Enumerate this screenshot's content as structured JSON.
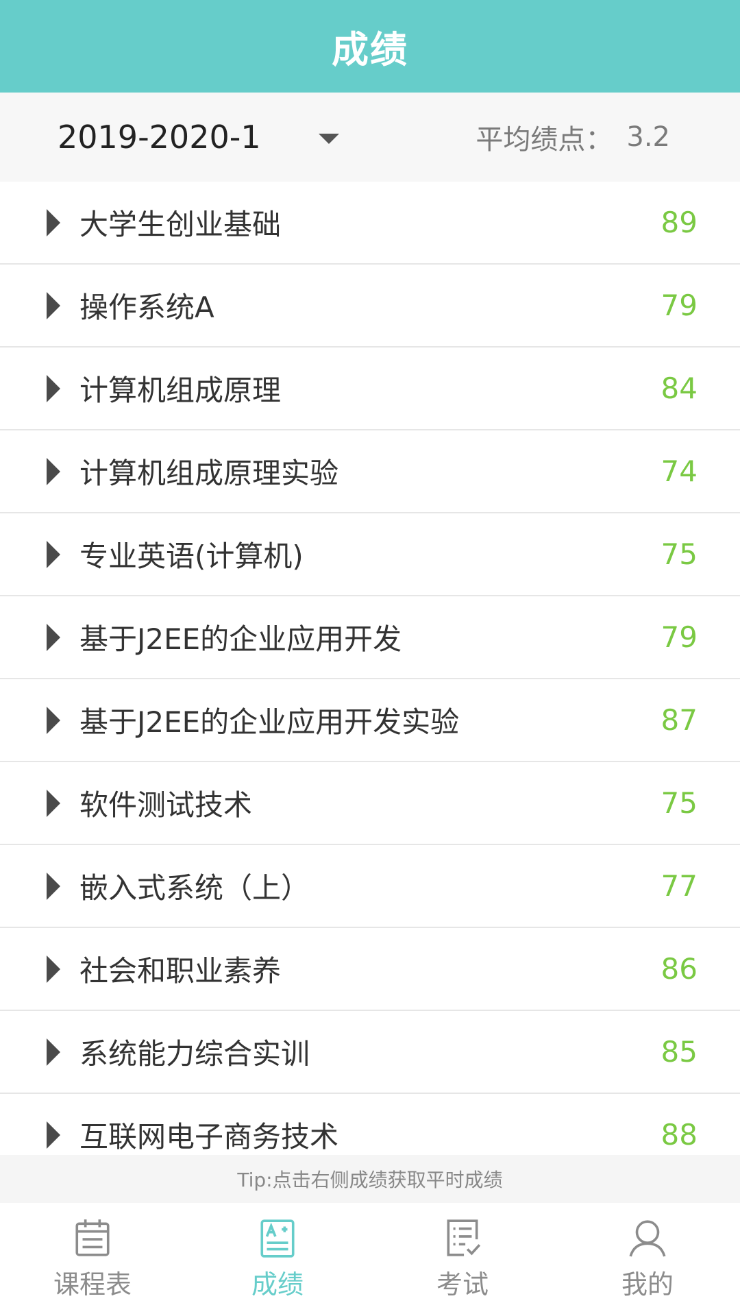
{
  "header": {
    "title": "成绩"
  },
  "term": {
    "selected": "2019-2020-1"
  },
  "gpa": {
    "label": "平均绩点：",
    "value": "3.2"
  },
  "courses": [
    {
      "name": "大学生创业基础",
      "score": "89"
    },
    {
      "name": "操作系统A",
      "score": "79"
    },
    {
      "name": "计算机组成原理",
      "score": "84"
    },
    {
      "name": "计算机组成原理实验",
      "score": "74"
    },
    {
      "name": "专业英语(计算机)",
      "score": "75"
    },
    {
      "name": "基于J2EE的企业应用开发",
      "score": "79"
    },
    {
      "name": "基于J2EE的企业应用开发实验",
      "score": "87"
    },
    {
      "name": "软件测试技术",
      "score": "75"
    },
    {
      "name": "嵌入式系统（上）",
      "score": "77"
    },
    {
      "name": "社会和职业素养",
      "score": "86"
    },
    {
      "name": "系统能力综合实训",
      "score": "85"
    },
    {
      "name": "互联网电子商务技术",
      "score": "88"
    }
  ],
  "tip": "Tip:点击右侧成绩获取平时成绩",
  "tabs": [
    {
      "label": "课程表",
      "icon": "calendar-icon",
      "active": false
    },
    {
      "label": "成绩",
      "icon": "grade-icon",
      "active": true
    },
    {
      "label": "考试",
      "icon": "exam-checklist-icon",
      "active": false
    },
    {
      "label": "我的",
      "icon": "user-icon",
      "active": false
    }
  ],
  "colors": {
    "accent": "#66cdca",
    "score": "#7ac943",
    "tab_inactive": "#8c8c8c"
  }
}
